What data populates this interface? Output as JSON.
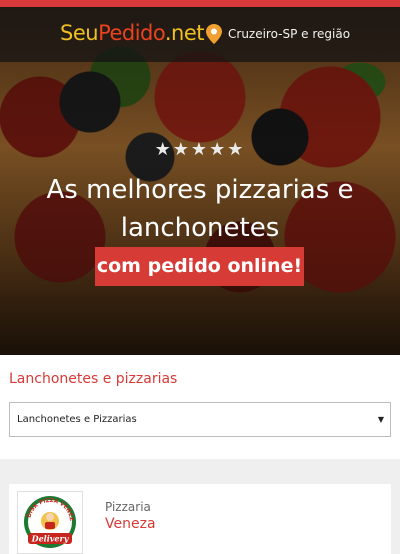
{
  "brand": {
    "logo_seu": "Seu",
    "logo_pedido": "Pedido",
    "logo_net": ".net",
    "accent_color": "#d63b36"
  },
  "location": {
    "icon": "location-pin-icon",
    "label": "Cruzeiro-SP e região"
  },
  "hero": {
    "rating_stars": "★★★★★",
    "headline_line1": "As melhores pizzarias e",
    "headline_line2": "lanchonetes",
    "cta_label": "com pedido online!"
  },
  "filter": {
    "title": "Lanchonetes e pizzarias",
    "selected_option": "Lanchonetes e Pizzarias",
    "dropdown_icon": "dropdown-arrow-icon"
  },
  "restaurants": [
    {
      "type": "Pizzaria",
      "name": "Veneza",
      "logo_text_top": "DISK PIZZA VENEZA",
      "logo_text_bottom": "Delivery"
    }
  ]
}
